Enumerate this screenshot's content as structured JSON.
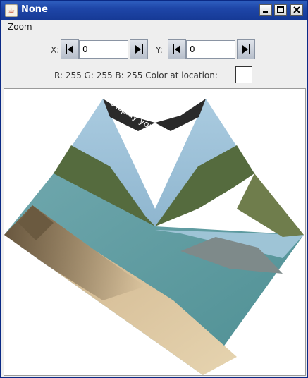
{
  "window": {
    "title": "None"
  },
  "menu": {
    "items": [
      "Zoom"
    ]
  },
  "controls": {
    "x_label": "X:",
    "x_value": "0",
    "y_label": "Y:",
    "y_value": "0"
  },
  "pixel_info": {
    "text": "R: 255 G: 255 B: 255 Color at location:",
    "swatch_color": "#ffffff"
  },
  "image_overlay_text": "Display your image"
}
